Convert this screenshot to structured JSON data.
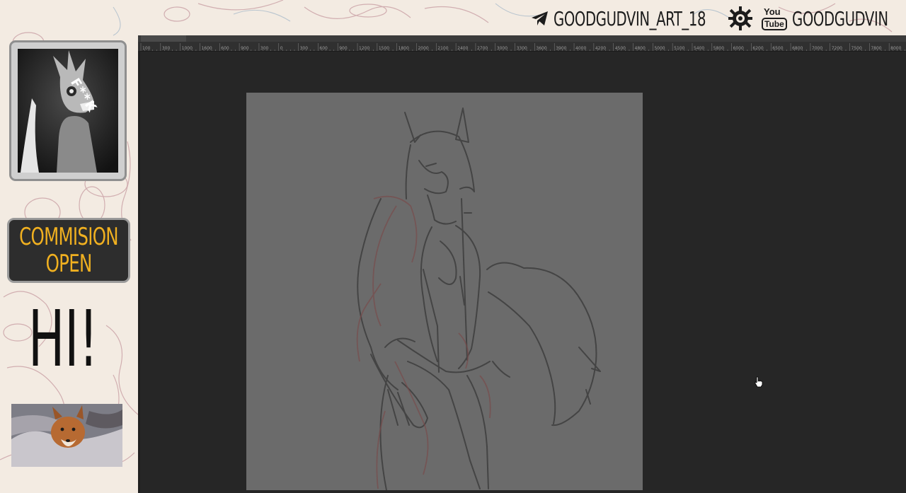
{
  "banner": {
    "telegram_handle": "GOODGUDVIN_ART_18",
    "youtube_handle": "GOODGUDVIN",
    "telegram_icon": "telegram-paper-plane-icon",
    "youtube_icon": "youtube-logo-icon",
    "gear_icon": "gear-splat-icon",
    "youtube_logo_top": "You",
    "youtube_logo_bottom": "Tube"
  },
  "sidebar": {
    "avatar_caption": "F**K",
    "commission_line1": "COMMISION",
    "commission_line2": "OPEN",
    "greeting": "HI!"
  },
  "ruler": {
    "labels": [
      "100",
      "300",
      "1000",
      "1600",
      "600",
      "900",
      "300",
      "0",
      "300",
      "600",
      "900",
      "1200",
      "1500",
      "1800",
      "2000",
      "2100",
      "2400",
      "2700",
      "3000",
      "3300",
      "3600",
      "3900",
      "4000",
      "4200",
      "4500",
      "4800",
      "5000",
      "5100",
      "5400",
      "5800",
      "6000",
      "6200",
      "6500",
      "6800",
      "7000",
      "7200",
      "7500",
      "7800",
      "8000"
    ]
  },
  "colors": {
    "accent": "#f0b020",
    "app_background": "#262626",
    "canvas": "#6b6b6b"
  }
}
